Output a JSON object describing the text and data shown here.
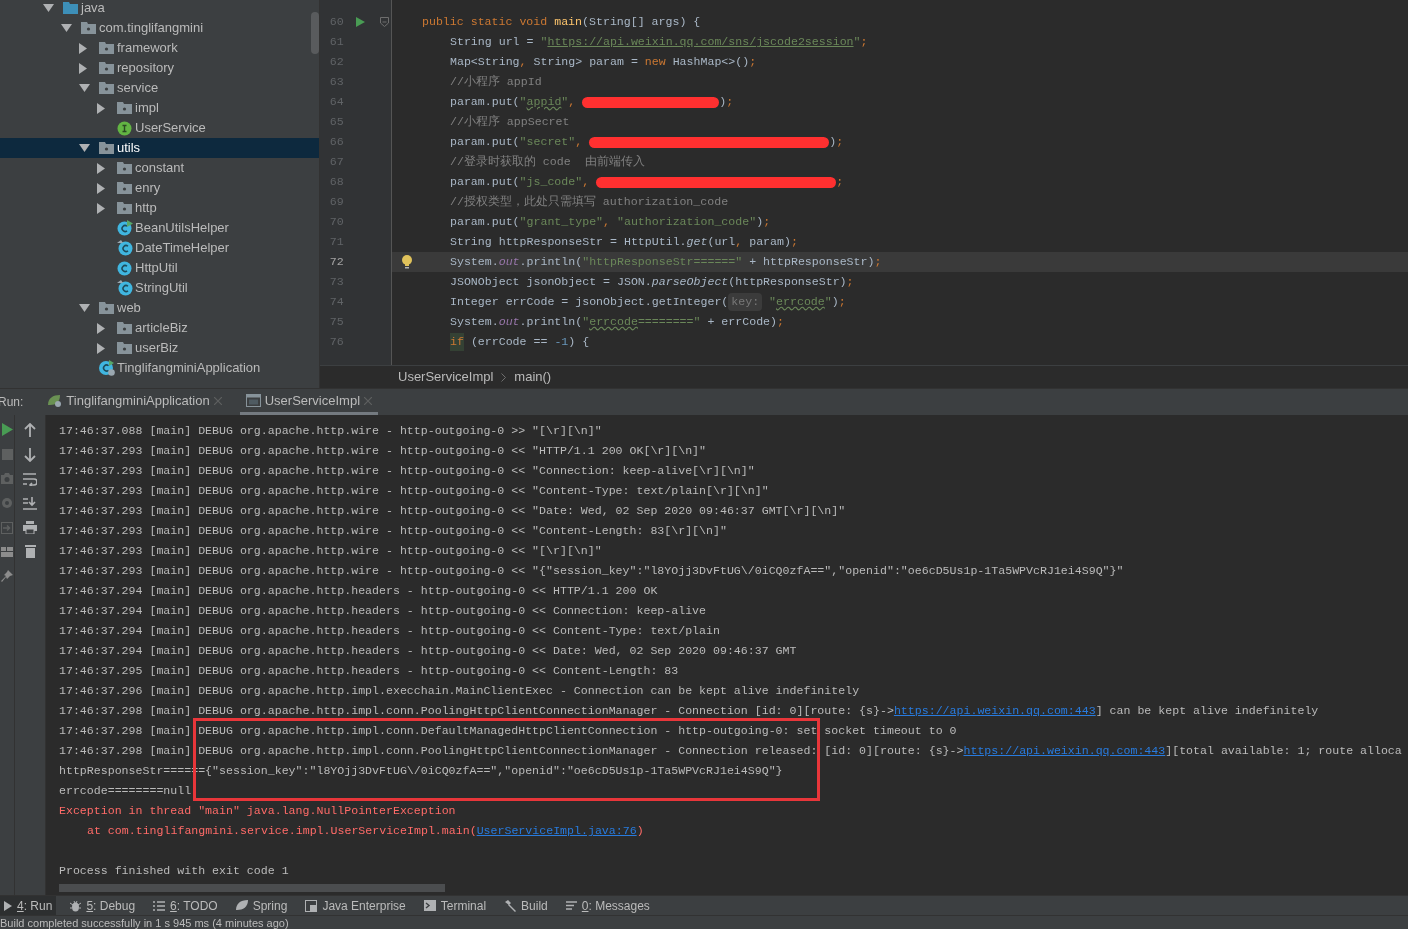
{
  "project_tree": [
    {
      "label": "java",
      "kind": "source-root",
      "expanded": true,
      "selected": false,
      "children": [
        {
          "label": "com.tinglifangmini",
          "kind": "package",
          "expanded": true,
          "selected": false,
          "children": [
            {
              "label": "framework",
              "kind": "package",
              "expanded": false,
              "selected": false
            },
            {
              "label": "repository",
              "kind": "package",
              "expanded": false,
              "selected": false
            },
            {
              "label": "service",
              "kind": "package",
              "expanded": true,
              "selected": false,
              "children": [
                {
                  "label": "impl",
                  "kind": "package",
                  "expanded": false,
                  "selected": false
                },
                {
                  "label": "UserService",
                  "kind": "interface",
                  "selected": false
                }
              ]
            },
            {
              "label": "utils",
              "kind": "package",
              "expanded": true,
              "selected": true,
              "children": [
                {
                  "label": "constant",
                  "kind": "package",
                  "expanded": false,
                  "selected": false
                },
                {
                  "label": "enry",
                  "kind": "package",
                  "expanded": false,
                  "selected": false
                },
                {
                  "label": "http",
                  "kind": "package",
                  "expanded": false,
                  "selected": false
                },
                {
                  "label": "BeanUtilsHelper",
                  "kind": "class-runnable",
                  "selected": false
                },
                {
                  "label": "DateTimeHelper",
                  "kind": "class-modified",
                  "selected": false
                },
                {
                  "label": "HttpUtil",
                  "kind": "class",
                  "selected": false
                },
                {
                  "label": "StringUtil",
                  "kind": "class-modified",
                  "selected": false
                }
              ]
            },
            {
              "label": "web",
              "kind": "package",
              "expanded": true,
              "selected": false,
              "children": [
                {
                  "label": "articleBiz",
                  "kind": "package",
                  "expanded": false,
                  "selected": false
                },
                {
                  "label": "userBiz",
                  "kind": "package",
                  "expanded": false,
                  "selected": false
                }
              ]
            },
            {
              "label": "TinglifangminiApplication",
              "kind": "spring-app",
              "selected": false
            }
          ]
        }
      ]
    }
  ],
  "code": [
    {
      "number": "60",
      "kind": "method",
      "current": false,
      "tokens": [
        {
          "kind": "keyword",
          "text": "public static void "
        },
        {
          "kind": "declaration",
          "text": "main"
        },
        {
          "kind": "plain",
          "text": "(String[] args) {"
        }
      ],
      "children": [
        {
          "number": "61",
          "kind": "statement",
          "current": false,
          "tokens": [
            {
              "kind": "plain",
              "text": "String url = "
            },
            {
              "kind": "string",
              "text": "\""
            },
            {
              "kind": "url",
              "text": "https://api.weixin.qq.com/sns/jscode2session"
            },
            {
              "kind": "string",
              "text": "\""
            },
            {
              "kind": "keyword",
              "text": ";"
            }
          ]
        },
        {
          "number": "62",
          "kind": "statement",
          "current": false,
          "tokens": [
            {
              "kind": "plain",
              "text": "Map<String"
            },
            {
              "kind": "keyword",
              "text": ","
            },
            {
              "kind": "plain",
              "text": " String> param = "
            },
            {
              "kind": "keyword",
              "text": "new"
            },
            {
              "kind": "plain",
              "text": " HashMap<>()"
            },
            {
              "kind": "keyword",
              "text": ";"
            }
          ]
        },
        {
          "number": "63",
          "kind": "statement",
          "current": false,
          "tokens": [
            {
              "kind": "comment",
              "text": "//小程序 appId"
            }
          ]
        },
        {
          "number": "64",
          "kind": "statement",
          "current": false,
          "tokens": [
            {
              "kind": "plain",
              "text": "param.put("
            },
            {
              "kind": "string",
              "text": "\""
            },
            {
              "kind": "typo-string",
              "text": "appid"
            },
            {
              "kind": "string",
              "text": "\""
            },
            {
              "kind": "keyword",
              "text": ", "
            },
            {
              "kind": "redacted-short"
            },
            {
              "kind": "plain",
              "text": ")"
            },
            {
              "kind": "keyword",
              "text": ";"
            }
          ]
        },
        {
          "number": "65",
          "kind": "statement",
          "current": false,
          "tokens": [
            {
              "kind": "comment",
              "text": "//小程序 appSecret"
            }
          ]
        },
        {
          "number": "66",
          "kind": "statement",
          "current": false,
          "tokens": [
            {
              "kind": "plain",
              "text": "param.put("
            },
            {
              "kind": "string",
              "text": "\"secret\""
            },
            {
              "kind": "keyword",
              "text": ", "
            },
            {
              "kind": "redacted-long"
            },
            {
              "kind": "plain",
              "text": ")"
            },
            {
              "kind": "keyword",
              "text": ";"
            }
          ]
        },
        {
          "number": "67",
          "kind": "statement",
          "current": false,
          "tokens": [
            {
              "kind": "comment",
              "text": "//登录时获取的 code  由前端传入"
            }
          ]
        },
        {
          "number": "68",
          "kind": "statement",
          "current": false,
          "tokens": [
            {
              "kind": "plain",
              "text": "param.put("
            },
            {
              "kind": "string",
              "text": "\"js_code\""
            },
            {
              "kind": "keyword",
              "text": ", "
            },
            {
              "kind": "redacted-long"
            },
            {
              "kind": "keyword",
              "text": ";"
            }
          ]
        },
        {
          "number": "69",
          "kind": "statement",
          "current": false,
          "tokens": [
            {
              "kind": "comment",
              "text": "//授权类型，此处只需填写 authorization_code"
            }
          ]
        },
        {
          "number": "70",
          "kind": "statement",
          "current": false,
          "tokens": [
            {
              "kind": "plain",
              "text": "param.put("
            },
            {
              "kind": "string",
              "text": "\"grant_type\""
            },
            {
              "kind": "keyword",
              "text": ", "
            },
            {
              "kind": "string",
              "text": "\"authorization_code\""
            },
            {
              "kind": "plain",
              "text": ")"
            },
            {
              "kind": "keyword",
              "text": ";"
            }
          ]
        },
        {
          "number": "71",
          "kind": "statement",
          "current": false,
          "tokens": [
            {
              "kind": "plain",
              "text": "String httpResponseStr = HttpUtil."
            },
            {
              "kind": "static-call",
              "text": "get"
            },
            {
              "kind": "plain",
              "text": "(url"
            },
            {
              "kind": "keyword",
              "text": ","
            },
            {
              "kind": "plain",
              "text": " param)"
            },
            {
              "kind": "keyword",
              "text": ";"
            }
          ]
        },
        {
          "number": "72",
          "kind": "intention",
          "current": true,
          "tokens": [
            {
              "kind": "plain",
              "text": "System."
            },
            {
              "kind": "field",
              "text": "out"
            },
            {
              "kind": "plain",
              "text": ".println("
            },
            {
              "kind": "string",
              "text": "\"httpResponseStr======\""
            },
            {
              "kind": "plain",
              "text": " + httpResponseStr)"
            },
            {
              "kind": "keyword",
              "text": ";"
            }
          ]
        },
        {
          "number": "73",
          "kind": "statement",
          "current": false,
          "tokens": [
            {
              "kind": "plain",
              "text": "JSONObject jsonObject = JSON."
            },
            {
              "kind": "static-call",
              "text": "parseObject"
            },
            {
              "kind": "plain",
              "text": "(httpResponseStr)"
            },
            {
              "kind": "keyword",
              "text": ";"
            }
          ]
        },
        {
          "number": "74",
          "kind": "statement",
          "current": false,
          "tokens": [
            {
              "kind": "plain",
              "text": "Integer errCode = jsonObject.getInteger("
            },
            {
              "kind": "hint",
              "text": "key:"
            },
            {
              "kind": "string",
              "text": " \""
            },
            {
              "kind": "typo-string",
              "text": "errcode"
            },
            {
              "kind": "string",
              "text": "\""
            },
            {
              "kind": "plain",
              "text": ")"
            },
            {
              "kind": "keyword",
              "text": ";"
            }
          ]
        },
        {
          "number": "75",
          "kind": "statement",
          "current": false,
          "tokens": [
            {
              "kind": "plain",
              "text": "System."
            },
            {
              "kind": "field",
              "text": "out"
            },
            {
              "kind": "plain",
              "text": ".println("
            },
            {
              "kind": "string",
              "text": "\""
            },
            {
              "kind": "typo-string",
              "text": "errcode"
            },
            {
              "kind": "string",
              "text": "========\""
            },
            {
              "kind": "plain",
              "text": " + errCode)"
            },
            {
              "kind": "keyword",
              "text": ";"
            }
          ]
        },
        {
          "number": "76",
          "kind": "statement",
          "current": false,
          "tokens": [
            {
              "kind": "keyword-match",
              "text": "if"
            },
            {
              "kind": "plain",
              "text": " (errCode == "
            },
            {
              "kind": "number",
              "text": "-1"
            },
            {
              "kind": "plain",
              "text": ") {"
            }
          ]
        }
      ]
    }
  ],
  "breadcrumb": [
    "UserServiceImpl",
    "main()"
  ],
  "run_panel": {
    "label": "Run:",
    "tabs": [
      {
        "label": "TinglifangminiApplication",
        "selected": false
      },
      {
        "label": "UserServiceImpl",
        "selected": true
      }
    ]
  },
  "console": [
    {
      "kind": "log",
      "text": "17:46:37.088 [main] DEBUG org.apache.http.wire - http-outgoing-0 >> \"[\\r][\\n]\""
    },
    {
      "kind": "log",
      "text": "17:46:37.293 [main] DEBUG org.apache.http.wire - http-outgoing-0 << \"HTTP/1.1 200 OK[\\r][\\n]\""
    },
    {
      "kind": "log",
      "text": "17:46:37.293 [main] DEBUG org.apache.http.wire - http-outgoing-0 << \"Connection: keep-alive[\\r][\\n]\""
    },
    {
      "kind": "log",
      "text": "17:46:37.293 [main] DEBUG org.apache.http.wire - http-outgoing-0 << \"Content-Type: text/plain[\\r][\\n]\""
    },
    {
      "kind": "log",
      "text": "17:46:37.293 [main] DEBUG org.apache.http.wire - http-outgoing-0 << \"Date: Wed, 02 Sep 2020 09:46:37 GMT[\\r][\\n]\""
    },
    {
      "kind": "log",
      "text": "17:46:37.293 [main] DEBUG org.apache.http.wire - http-outgoing-0 << \"Content-Length: 83[\\r][\\n]\""
    },
    {
      "kind": "log",
      "text": "17:46:37.293 [main] DEBUG org.apache.http.wire - http-outgoing-0 << \"[\\r][\\n]\""
    },
    {
      "kind": "log",
      "text": "17:46:37.293 [main] DEBUG org.apache.http.wire - http-outgoing-0 << \"{\"session_key\":\"l8YOjj3DvFtUG\\/0iCQ0zfA==\",\"openid\":\"oe6cD5Us1p-1Ta5WPVcRJ1ei4S9Q\"}\""
    },
    {
      "kind": "log",
      "text": "17:46:37.294 [main] DEBUG org.apache.http.headers - http-outgoing-0 << HTTP/1.1 200 OK"
    },
    {
      "kind": "log",
      "text": "17:46:37.294 [main] DEBUG org.apache.http.headers - http-outgoing-0 << Connection: keep-alive"
    },
    {
      "kind": "log",
      "text": "17:46:37.294 [main] DEBUG org.apache.http.headers - http-outgoing-0 << Content-Type: text/plain"
    },
    {
      "kind": "log",
      "text": "17:46:37.294 [main] DEBUG org.apache.http.headers - http-outgoing-0 << Date: Wed, 02 Sep 2020 09:46:37 GMT"
    },
    {
      "kind": "log",
      "text": "17:46:37.295 [main] DEBUG org.apache.http.headers - http-outgoing-0 << Content-Length: 83"
    },
    {
      "kind": "log",
      "text": "17:46:37.296 [main] DEBUG org.apache.http.impl.execchain.MainClientExec - Connection can be kept alive indefinitely"
    },
    {
      "kind": "log",
      "parts": [
        {
          "kind": "text",
          "text": "17:46:37.298 [main] DEBUG org.apache.http.impl.conn.PoolingHttpClientConnectionManager - Connection [id: 0][route: {s}->"
        },
        {
          "kind": "link",
          "text": "https://api.weixin.qq.com:443"
        },
        {
          "kind": "text",
          "text": "] can be kept alive indefinitely"
        }
      ]
    },
    {
      "kind": "log",
      "text": "17:46:37.298 [main] DEBUG org.apache.http.impl.conn.DefaultManagedHttpClientConnection - http-outgoing-0: set socket timeout to 0"
    },
    {
      "kind": "log",
      "parts": [
        {
          "kind": "text",
          "text": "17:46:37.298 [main] DEBUG org.apache.http.impl.conn.PoolingHttpClientConnectionManager - Connection released: [id: 0][route: {s}->"
        },
        {
          "kind": "link",
          "text": "https://api.weixin.qq.com:443"
        },
        {
          "kind": "text",
          "text": "][total available: 1; route alloca"
        }
      ]
    },
    {
      "kind": "log",
      "text": "httpResponseStr======{\"session_key\":\"l8YOjj3DvFtUG\\/0iCQ0zfA==\",\"openid\":\"oe6cD5Us1p-1Ta5WPVcRJ1ei4S9Q\"}"
    },
    {
      "kind": "log",
      "text": "errcode========null"
    },
    {
      "kind": "error",
      "text": "Exception in thread \"main\" java.lang.NullPointerException"
    },
    {
      "kind": "trace",
      "parts": [
        {
          "kind": "text",
          "text": "at com.tinglifangmini.service.impl.UserServiceImpl.main("
        },
        {
          "kind": "link",
          "text": "UserServiceImpl.java:76"
        },
        {
          "kind": "text",
          "text": ")"
        }
      ]
    },
    {
      "kind": "exit",
      "text": "Process finished with exit code 1"
    }
  ],
  "tool_windows": [
    {
      "number": "4",
      "label": ": Run",
      "selected": true
    },
    {
      "number": "5",
      "label": ": Debug",
      "selected": false
    },
    {
      "number": "6",
      "label": ": TODO",
      "selected": false
    },
    {
      "label": "Spring",
      "selected": false
    },
    {
      "label": "Java Enterprise",
      "selected": false
    },
    {
      "label": "Terminal",
      "selected": false
    },
    {
      "label": "Build",
      "selected": false
    },
    {
      "number": "0",
      "label": ": Messages",
      "selected": false
    }
  ],
  "status_bar": "Build completed successfully in 1 s 945 ms (4 minutes ago)"
}
